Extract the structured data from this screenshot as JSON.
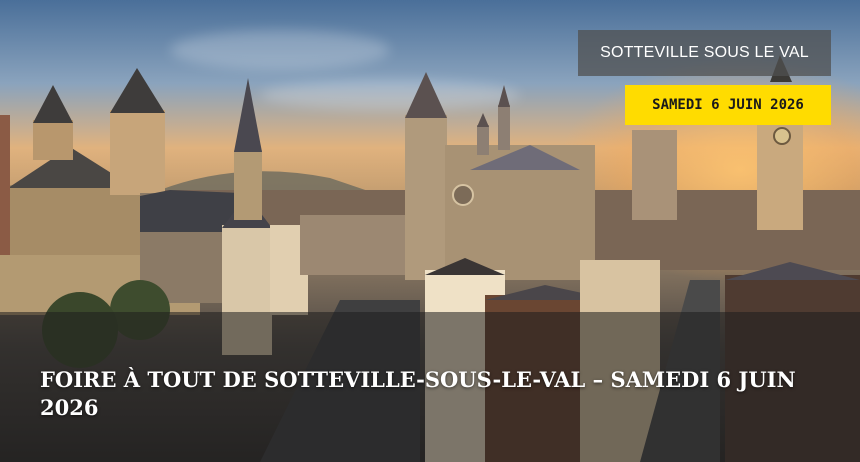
{
  "event": {
    "location_badge": "SOTTEVILLE SOUS LE VAL",
    "date_badge": "SAMEDI 6 JUIN 2026",
    "title": "FOIRE À TOUT DE SOTTEVILLE-SOUS-LE-VAL – SAMEDI 6 JUIN 2026"
  },
  "colors": {
    "date_badge_bg": "#ffdc00",
    "location_badge_bg": "#505050",
    "title_text": "#ffffff"
  },
  "image": {
    "subject": "cityscape-photo"
  }
}
